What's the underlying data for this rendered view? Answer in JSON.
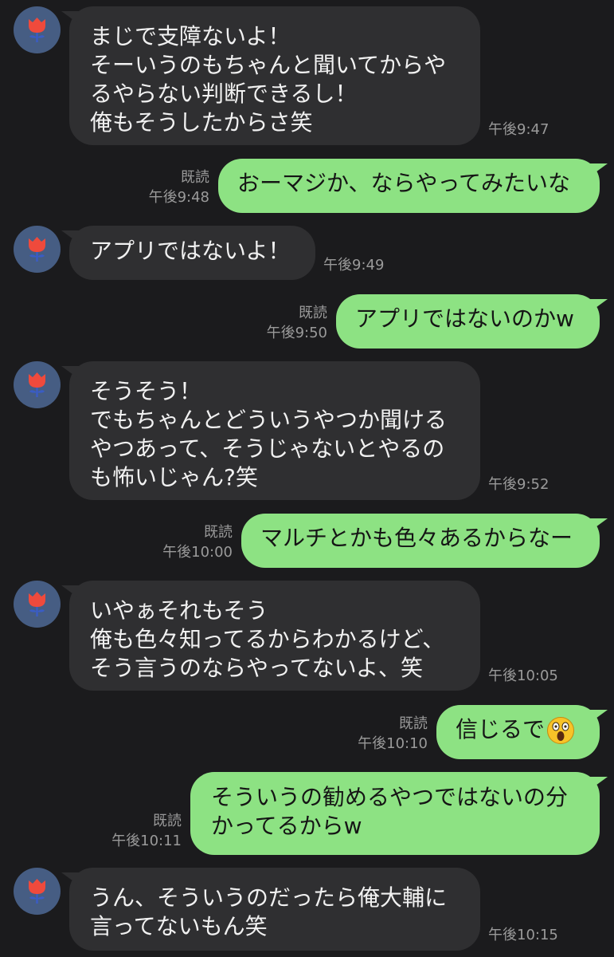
{
  "chat": {
    "messages": [
      {
        "side": "in",
        "text": "まじで支障ないよ！\nそーいうのもちゃんと聞いてからや\nるやらない判断できるし！\n俺もそうしたからさ笑",
        "time": "午後9:47"
      },
      {
        "side": "out",
        "text": "おーマジか、ならやってみたいな",
        "read": "既読",
        "time": "午後9:48"
      },
      {
        "side": "in",
        "text": "アプリではないよ！",
        "time": "午後9:49"
      },
      {
        "side": "out",
        "text": "アプリではないのかw",
        "read": "既読",
        "time": "午後9:50"
      },
      {
        "side": "in",
        "text": "そうそう！\nでもちゃんとどういうやつか聞ける\nやつあって、そうじゃないとやるの\nも怖いじゃん?笑",
        "time": "午後9:52"
      },
      {
        "side": "out",
        "text": "マルチとかも色々あるからなー",
        "read": "既読",
        "time": "午後10:00"
      },
      {
        "side": "in",
        "text": "いやぁそれもそう\n俺も色々知ってるからわかるけど、\nそう言うのならやってないよ、笑",
        "time": "午後10:05"
      },
      {
        "side": "out",
        "text": "信じるで",
        "emoji": "shocked-face-emoji",
        "read": "既読",
        "time": "午後10:10"
      },
      {
        "side": "out",
        "text": "そういうの勧めるやつではないの分\nかってるからw",
        "read": "既読",
        "time": "午後10:11"
      },
      {
        "side": "in",
        "text": "うん、そういうのだったら俺大輔に\n言ってないもん笑",
        "time": "午後10:15"
      }
    ]
  },
  "colors": {
    "background": "#1b1b1d",
    "incoming_bubble": "#2f2f31",
    "outgoing_bubble": "#8de283",
    "avatar": "#465d83",
    "meta_text": "#9a9a9a"
  },
  "icons": {
    "avatar": "tulip-avatar-icon"
  }
}
